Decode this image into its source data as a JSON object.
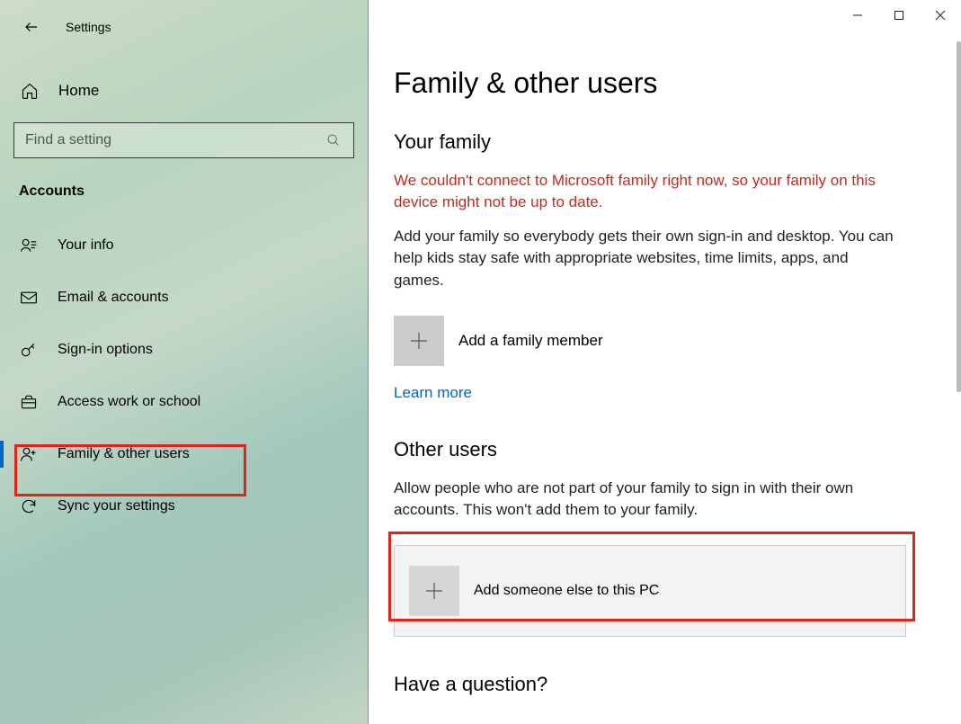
{
  "app_title": "Settings",
  "home_label": "Home",
  "search": {
    "placeholder": "Find a setting"
  },
  "category": "Accounts",
  "nav": {
    "items": [
      {
        "label": "Your info"
      },
      {
        "label": "Email & accounts"
      },
      {
        "label": "Sign-in options"
      },
      {
        "label": "Access work or school"
      },
      {
        "label": "Family & other users"
      },
      {
        "label": "Sync your settings"
      }
    ]
  },
  "main": {
    "heading": "Family & other users",
    "family": {
      "heading": "Your family",
      "error": "We couldn't connect to Microsoft family right now, so your family on this device might not be up to date.",
      "desc": "Add your family so everybody gets their own sign-in and desktop. You can help kids stay safe with appropriate websites, time limits, apps, and games.",
      "add_label": "Add a family member",
      "learn_more": "Learn more"
    },
    "other": {
      "heading": "Other users",
      "desc": "Allow people who are not part of your family to sign in with their own accounts. This won't add them to your family.",
      "add_label": "Add someone else to this PC"
    },
    "question_heading": "Have a question?"
  }
}
